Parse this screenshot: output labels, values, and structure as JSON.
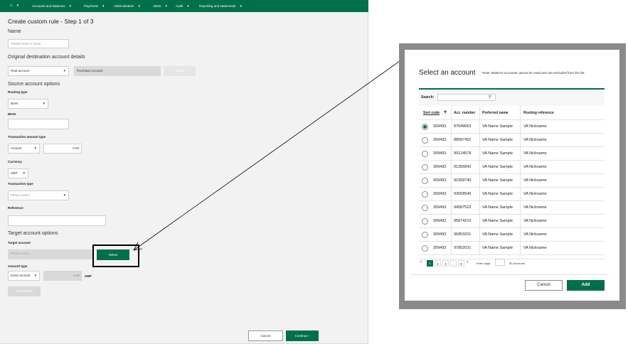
{
  "nav": {
    "home_icon": "home-icon",
    "items": [
      {
        "label": "Accounts and balances"
      },
      {
        "label": "Payments"
      },
      {
        "label": "Administration"
      },
      {
        "label": "Alerts"
      },
      {
        "label": "Audit"
      },
      {
        "label": "Reporting and statements"
      }
    ]
  },
  "page": {
    "title": "Create custom rule - Step 1 of 3",
    "name_label": "Name",
    "name_placeholder": "Please enter a name",
    "dest_heading": "Original destination account details",
    "dest_type": "Real account",
    "dest_account": "Purchase Account",
    "dest_button": "Select",
    "source_heading": "Source account options",
    "routing_label": "Routing type",
    "routing_value": "IBAN",
    "iban_label": "IBAN",
    "amount_type_label": "Transaction amount type",
    "amount_type_value": "Amount",
    "amount_value": "0.00",
    "currency_label": "Currency",
    "currency_value": "GBP",
    "transaction_type_label": "Transaction type",
    "transaction_type_placeholder": "Please select",
    "reference_label": "Reference",
    "target_heading": "Target account options",
    "target_account_label": "Target account",
    "target_account_placeholder": "Please select",
    "select_button": "Select",
    "amount_type2_label": "Amount type",
    "amount_type2_value": "Exact amount",
    "amount2_value": "0.00",
    "amount2_currency": "GBP",
    "add_another": "Add Another",
    "cancel": "Cancel",
    "continue": "Continue ›"
  },
  "modal": {
    "title": "Select an account",
    "note": "*Note: Balance accounts cannot be used and are excluded from the list.",
    "search_label": "Search:",
    "columns": [
      "Sort code",
      "Acc. number",
      "Preferred name",
      "Routing reference"
    ],
    "rows": [
      {
        "sort": "309493",
        "acc": "87549653",
        "name": "VA Name Sample",
        "ref": "VA Nickname",
        "selected": true
      },
      {
        "sort": "309493",
        "acc": "88587452",
        "name": "VA Name Sample",
        "ref": "VA Nickname",
        "selected": false
      },
      {
        "sort": "309493",
        "acc": "90124578",
        "name": "VA Name Sample",
        "ref": "VA Nickname",
        "selected": false
      },
      {
        "sort": "309493",
        "acc": "91356842",
        "name": "VA Name Sample",
        "ref": "VA Nickname",
        "selected": false
      },
      {
        "sort": "309493",
        "acc": "92358740",
        "name": "VA Name Sample",
        "ref": "VA Nickname",
        "selected": false
      },
      {
        "sort": "309493",
        "acc": "93658545",
        "name": "VA Name Sample",
        "ref": "VA Nickname",
        "selected": false
      },
      {
        "sort": "309493",
        "acc": "94587523",
        "name": "VA Name Sample",
        "ref": "VA Nickname",
        "selected": false
      },
      {
        "sort": "309493",
        "acc": "95874210",
        "name": "VA Name Sample",
        "ref": "VA Nickname",
        "selected": false
      },
      {
        "sort": "309493",
        "acc": "96853201",
        "name": "VA Name Sample",
        "ref": "VA Nickname",
        "selected": false
      },
      {
        "sort": "309493",
        "acc": "97852031",
        "name": "VA Name Sample",
        "ref": "VA Nickname",
        "selected": false
      }
    ],
    "pages": [
      "1",
      "2",
      "3",
      "..",
      "8"
    ],
    "enter_page": "Enter page",
    "count": "80 Accounts",
    "cancel": "Cancel",
    "add": "Add"
  },
  "colors": {
    "brand": "#00704a"
  }
}
